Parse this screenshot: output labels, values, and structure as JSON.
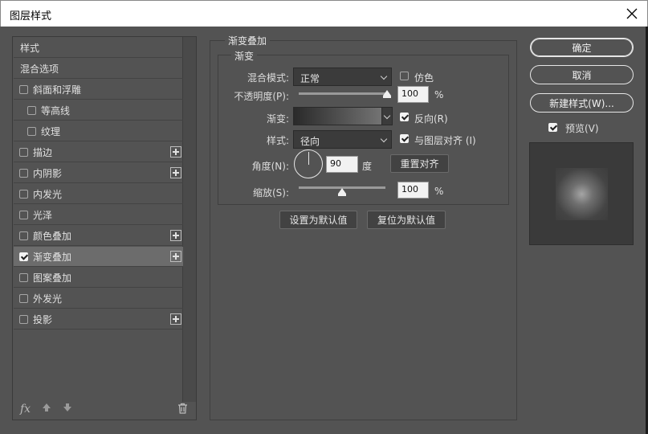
{
  "window": {
    "title": "图层样式",
    "close_icon": "close-icon"
  },
  "sidebar": {
    "items": [
      {
        "label": "样式",
        "checkbox": false,
        "checked": false,
        "plus": false,
        "selected": false,
        "indent": false
      },
      {
        "label": "混合选项",
        "checkbox": false,
        "checked": false,
        "plus": false,
        "selected": false,
        "indent": false
      },
      {
        "label": "斜面和浮雕",
        "checkbox": true,
        "checked": false,
        "plus": false,
        "selected": false,
        "indent": false
      },
      {
        "label": "等高线",
        "checkbox": true,
        "checked": false,
        "plus": false,
        "selected": false,
        "indent": true
      },
      {
        "label": "纹理",
        "checkbox": true,
        "checked": false,
        "plus": false,
        "selected": false,
        "indent": true
      },
      {
        "label": "描边",
        "checkbox": true,
        "checked": false,
        "plus": true,
        "selected": false,
        "indent": false
      },
      {
        "label": "内阴影",
        "checkbox": true,
        "checked": false,
        "plus": true,
        "selected": false,
        "indent": false
      },
      {
        "label": "内发光",
        "checkbox": true,
        "checked": false,
        "plus": false,
        "selected": false,
        "indent": false
      },
      {
        "label": "光泽",
        "checkbox": true,
        "checked": false,
        "plus": false,
        "selected": false,
        "indent": false
      },
      {
        "label": "颜色叠加",
        "checkbox": true,
        "checked": false,
        "plus": true,
        "selected": false,
        "indent": false
      },
      {
        "label": "渐变叠加",
        "checkbox": true,
        "checked": true,
        "plus": true,
        "selected": true,
        "indent": false
      },
      {
        "label": "图案叠加",
        "checkbox": true,
        "checked": false,
        "plus": false,
        "selected": false,
        "indent": false
      },
      {
        "label": "外发光",
        "checkbox": true,
        "checked": false,
        "plus": false,
        "selected": false,
        "indent": false
      },
      {
        "label": "投影",
        "checkbox": true,
        "checked": false,
        "plus": true,
        "selected": false,
        "indent": false
      }
    ],
    "bottom": {
      "fx": "fx",
      "fx_icon": "fx-icon",
      "up_icon": "arrow-up-icon",
      "down_icon": "arrow-down-icon",
      "trash_icon": "trash-icon"
    }
  },
  "gradient_overlay": {
    "group_title": "渐变叠加",
    "sub_title": "渐变",
    "blend_mode_label": "混合模式:",
    "blend_mode_value": "正常",
    "dither_label": "仿色",
    "dither_checked": false,
    "opacity_label": "不透明度(P):",
    "opacity_value": "100",
    "opacity_unit": "%",
    "opacity_level": 1.0,
    "gradient_label": "渐变:",
    "reverse_label": "反向(R)",
    "reverse_checked": true,
    "style_label": "样式:",
    "style_value": "径向",
    "align_label": "与图层对齐 (I)",
    "align_checked": true,
    "angle_label": "角度(N):",
    "angle_value": "90",
    "angle_unit": "度",
    "reset_align_label": "重置对齐",
    "scale_label": "缩放(S):",
    "scale_value": "100",
    "scale_unit": "%",
    "scale_level": 0.5,
    "set_default_label": "设置为默认值",
    "reset_default_label": "复位为默认值"
  },
  "actions": {
    "ok_label": "确定",
    "cancel_label": "取消",
    "new_style_label": "新建样式(W)...",
    "preview_label": "预览(V)",
    "preview_checked": true
  }
}
